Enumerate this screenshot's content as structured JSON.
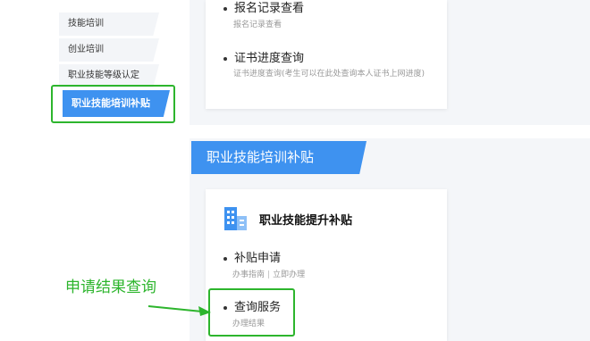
{
  "sidebar": {
    "items": [
      {
        "label": "技能培训"
      },
      {
        "label": "创业培训"
      },
      {
        "label": "职业技能等级认定"
      },
      {
        "label": "职业技能培训补贴"
      }
    ]
  },
  "upper_card": {
    "items": [
      {
        "title": "报名记录查看",
        "sub": "报名记录查看"
      },
      {
        "title": "证书进度查询",
        "sub": "证书进度查询(考生可以在此处查询本人证书上网进度)"
      }
    ]
  },
  "section": {
    "banner": "职业技能培训补贴",
    "card_heading": "职业技能提升补贴",
    "apply": {
      "title": "补贴申请",
      "link_guide": "办事指南",
      "separator": "|",
      "link_apply": "立即办理"
    },
    "query": {
      "title": "查询服务",
      "sub": "办理结果"
    }
  },
  "annotation": {
    "text": "申请结果查询",
    "color": "#2db52d"
  },
  "colors": {
    "accent": "#3e92f0",
    "highlight": "#2db52d"
  }
}
